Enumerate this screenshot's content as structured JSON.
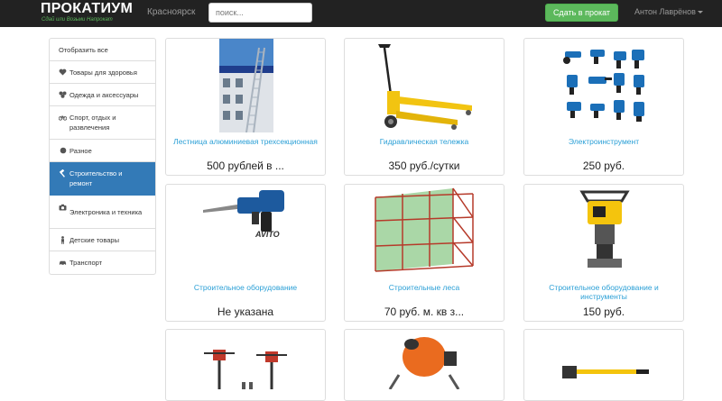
{
  "header": {
    "brand": "ПРОКАТИУМ",
    "tagline": "Сдай или Возьми Напрокат",
    "city": "Красноярск",
    "search_placeholder": "поиск...",
    "rent_button": "Сдать в прокат",
    "user_name": "Антон Лаврёнов"
  },
  "sidebar": {
    "items": [
      {
        "label": "Отобразить все",
        "icon": ""
      },
      {
        "label": "Товары для здоровья",
        "icon": "heart-icon"
      },
      {
        "label": "Одежда и аксессуары",
        "icon": "clothes-icon"
      },
      {
        "label": "Спорт, отдых и развлечения",
        "icon": "bicycle-icon"
      },
      {
        "label": "Разное",
        "icon": "dot-icon"
      },
      {
        "label": "Строительство и ремонт",
        "icon": "hammer-icon",
        "active": true
      },
      {
        "label": "Электроника и техника",
        "icon": "camera-icon"
      },
      {
        "label": "Детские товары",
        "icon": "child-icon"
      },
      {
        "label": "Транспорт",
        "icon": "car-icon"
      }
    ]
  },
  "products": [
    {
      "title": "Лестница алюминиевая трехсекционная",
      "price": "500 рублей в ..."
    },
    {
      "title": "Гидравлическая тележка",
      "price": "350 руб./сутки"
    },
    {
      "title": "Электроинструмент",
      "price": "250 руб."
    },
    {
      "title": "Строительное оборудование",
      "price": "Не указана"
    },
    {
      "title": "Строительные леса",
      "price": "70 руб. м. кв з..."
    },
    {
      "title": "Строительное оборудование и инструменты",
      "price": "150 руб."
    },
    {
      "title": "",
      "price": ""
    },
    {
      "title": "",
      "price": ""
    },
    {
      "title": "",
      "price": ""
    }
  ],
  "colors": {
    "navbar": "#222222",
    "accent_green": "#5cb85c",
    "link_blue": "#2a9fd6",
    "active_blue": "#337ab7"
  }
}
